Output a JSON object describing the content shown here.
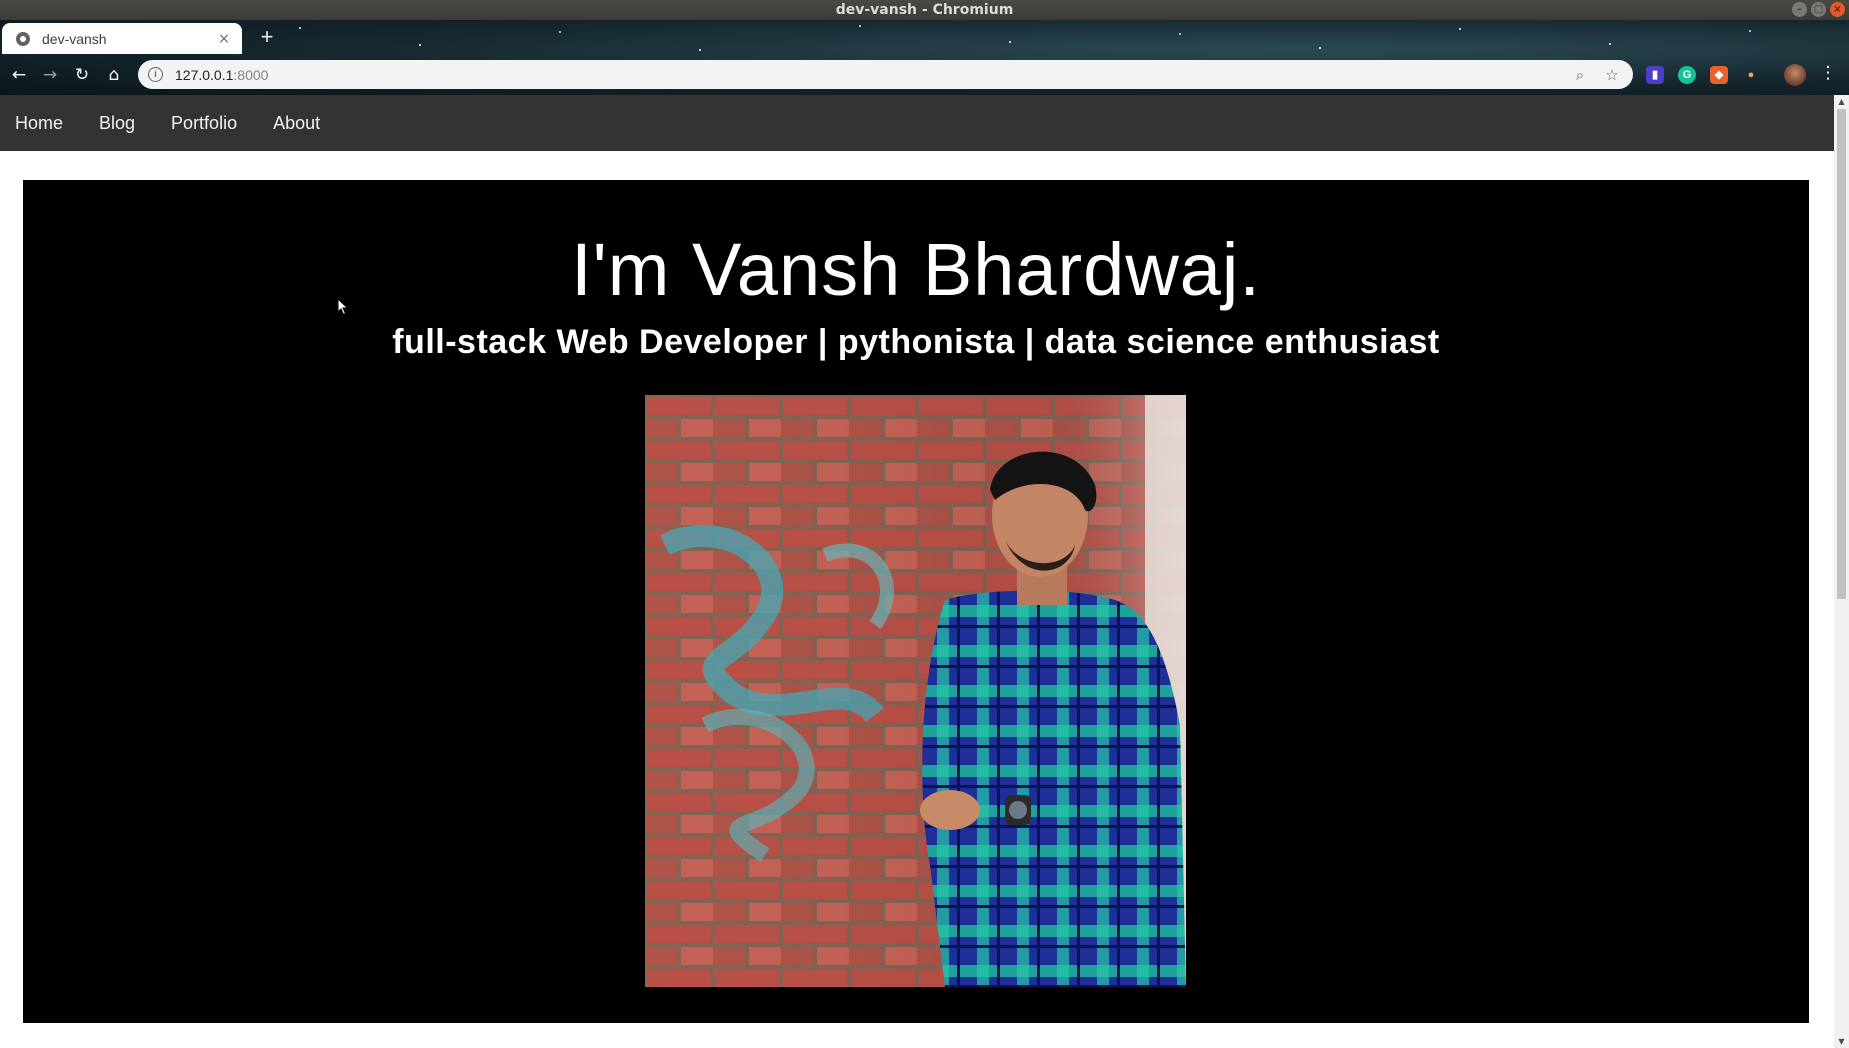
{
  "window": {
    "title": "dev-vansh - Chromium"
  },
  "browser": {
    "tab": {
      "title": "dev-vansh",
      "close_glyph": "×"
    },
    "new_tab_glyph": "+",
    "url": {
      "host": "127.0.0.1",
      "port": ":8000"
    },
    "icons": {
      "back": "back-arrow-icon",
      "forward": "forward-arrow-icon",
      "reload": "reload-icon",
      "home": "home-icon",
      "info": "info-icon",
      "zoom": "zoom-icon",
      "bookmark": "star-icon",
      "menu": "kebab-menu-icon"
    },
    "extensions": [
      {
        "name": "extension-purple-icon",
        "color": "#4b3fc7",
        "glyph": "▮"
      },
      {
        "name": "grammarly-icon",
        "color": "#15c39a",
        "glyph": "G"
      },
      {
        "name": "extension-orange-icon",
        "color": "#e8632b",
        "glyph": "◆"
      },
      {
        "name": "extension-light-icon",
        "color": "#f4a259",
        "glyph": "●"
      }
    ]
  },
  "page": {
    "nav": [
      {
        "label": "Home"
      },
      {
        "label": "Blog"
      },
      {
        "label": "Portfolio"
      },
      {
        "label": "About"
      }
    ],
    "hero": {
      "title": "I'm Vansh Bhardwaj.",
      "subtitle": "full-stack Web Developer | pythonista | data science enthusiast"
    },
    "colors": {
      "nav_background": "#333333",
      "hero_background": "#000000",
      "text": "#ffffff"
    }
  }
}
